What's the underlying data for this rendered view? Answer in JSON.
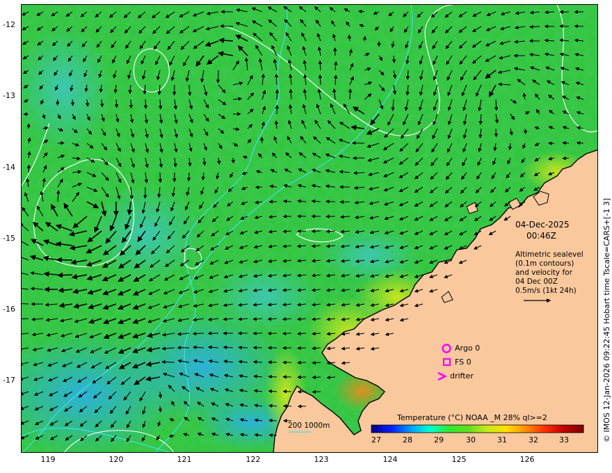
{
  "map": {
    "date": "04-Dec-2025",
    "time": "00:46Z",
    "description_lines": [
      "Altimetric sealevel",
      "(0.1m contours)",
      "and velocity for",
      "04 Dec 00Z",
      "0.5m/s (1kt 24h)"
    ],
    "y_ticks": [
      "-12",
      "-13",
      "-14",
      "-15",
      "-16",
      "-17"
    ],
    "x_ticks": [
      "119",
      "120",
      "121",
      "122",
      "123",
      "124",
      "125",
      "126"
    ],
    "legend": {
      "argo": "Argo 0",
      "fs": "FS 0",
      "drifter": "drifter"
    },
    "depth_scale": "200  1000m",
    "colorbar": {
      "title": "Temperature (°C) NOAA _M 28% ql>=2",
      "ticks": [
        "27",
        "28",
        "29",
        "30",
        "31",
        "32",
        "33"
      ]
    },
    "credit": "© IMOS 12-Jan-2026 09:22:45 Hobart time Tscale=CARS+[-1 3]",
    "colors": {
      "land": "#f9c89c",
      "sea_main": "#2fc43a",
      "contour": "#ffffff",
      "isobath": "#3fe0e8",
      "legend_marker": "#ff00ff"
    }
  }
}
